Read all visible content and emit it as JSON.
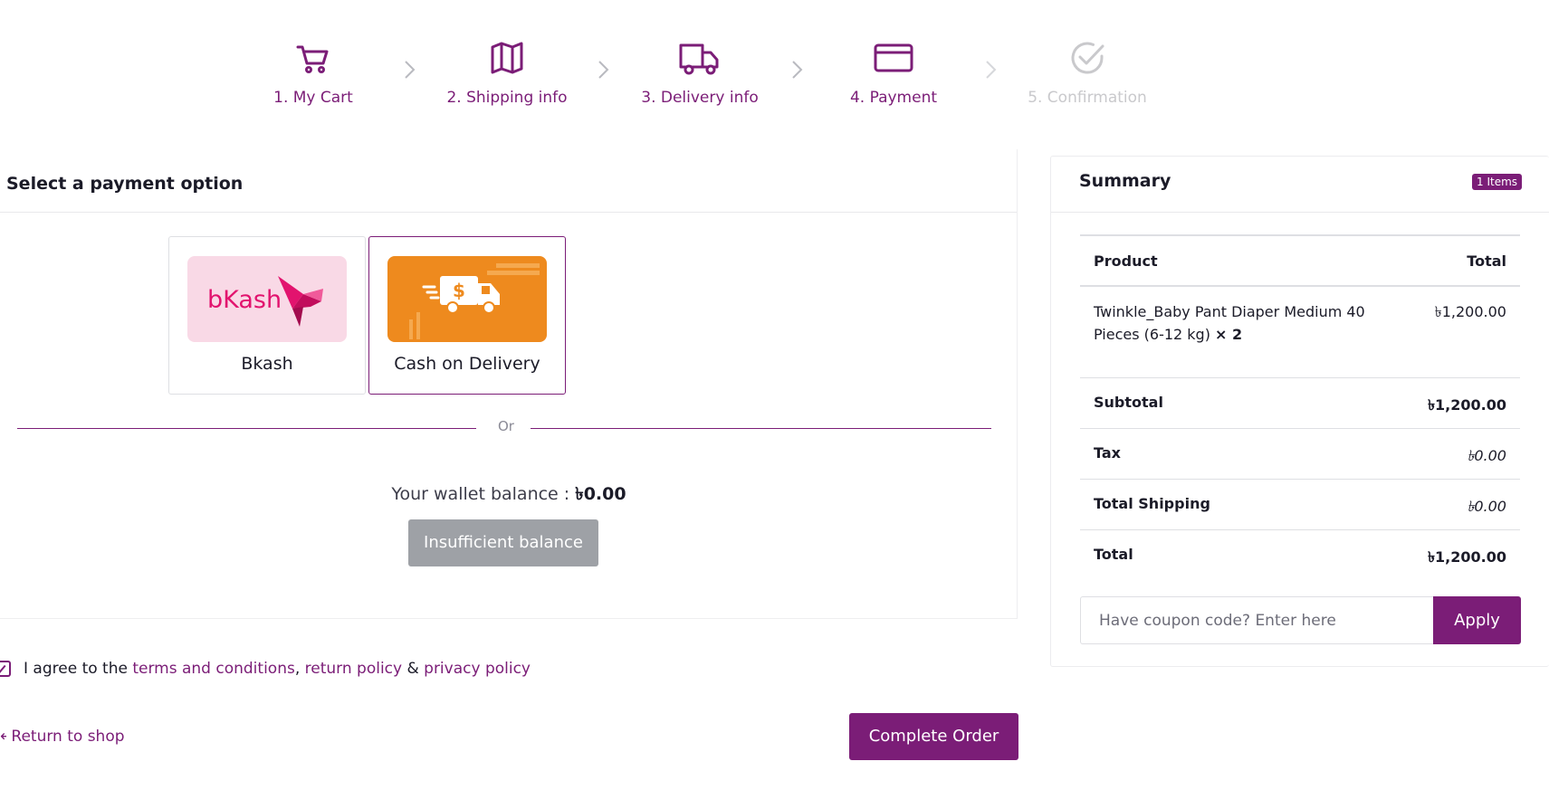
{
  "steps": [
    {
      "label": "1. My Cart",
      "icon": "cart-icon"
    },
    {
      "label": "2. Shipping info",
      "icon": "map-icon"
    },
    {
      "label": "3. Delivery info",
      "icon": "truck-icon"
    },
    {
      "label": "4. Payment",
      "icon": "card-icon"
    },
    {
      "label": "5. Confirmation",
      "icon": "check-circle-icon"
    }
  ],
  "payment": {
    "heading": "Select a payment option",
    "options": [
      {
        "name": "Bkash",
        "logo_text": "bKash",
        "selected": false
      },
      {
        "name": "Cash on Delivery",
        "selected": true
      }
    ],
    "or_text": "Or",
    "wallet_label": "Your wallet balance : ",
    "wallet_value": "৳0.00",
    "insufficient_label": "Insufficient balance"
  },
  "agree": {
    "prefix": "I agree to the ",
    "terms": "terms and conditions",
    "sep1": ", ",
    "return_policy": "return policy",
    "sep2": " & ",
    "privacy_policy": "privacy policy",
    "checked": true
  },
  "return_link": "Return to shop",
  "complete_button": "Complete Order",
  "summary": {
    "title": "Summary",
    "badge": "1 Items",
    "col_product": "Product",
    "col_total": "Total",
    "items": [
      {
        "name": "Twinkle_Baby Pant Diaper Medium 40 Pieces (6-12 kg)",
        "qty": "× 2",
        "total": "৳1,200.00"
      }
    ],
    "subtotal_label": "Subtotal",
    "subtotal": "৳1,200.00",
    "tax_label": "Tax",
    "tax": "৳0.00",
    "shipping_label": "Total Shipping",
    "shipping": "৳0.00",
    "total_label": "Total",
    "total": "৳1,200.00",
    "coupon_placeholder": "Have coupon code? Enter here",
    "apply_label": "Apply"
  },
  "colors": {
    "accent": "#7b1d77",
    "muted": "#c9c9cc",
    "cod_orange": "#ee8a1e",
    "bkash_pink": "#f9d9e6",
    "bkash_magenta": "#e2136e",
    "disabled_button": "#9ea1a6"
  }
}
